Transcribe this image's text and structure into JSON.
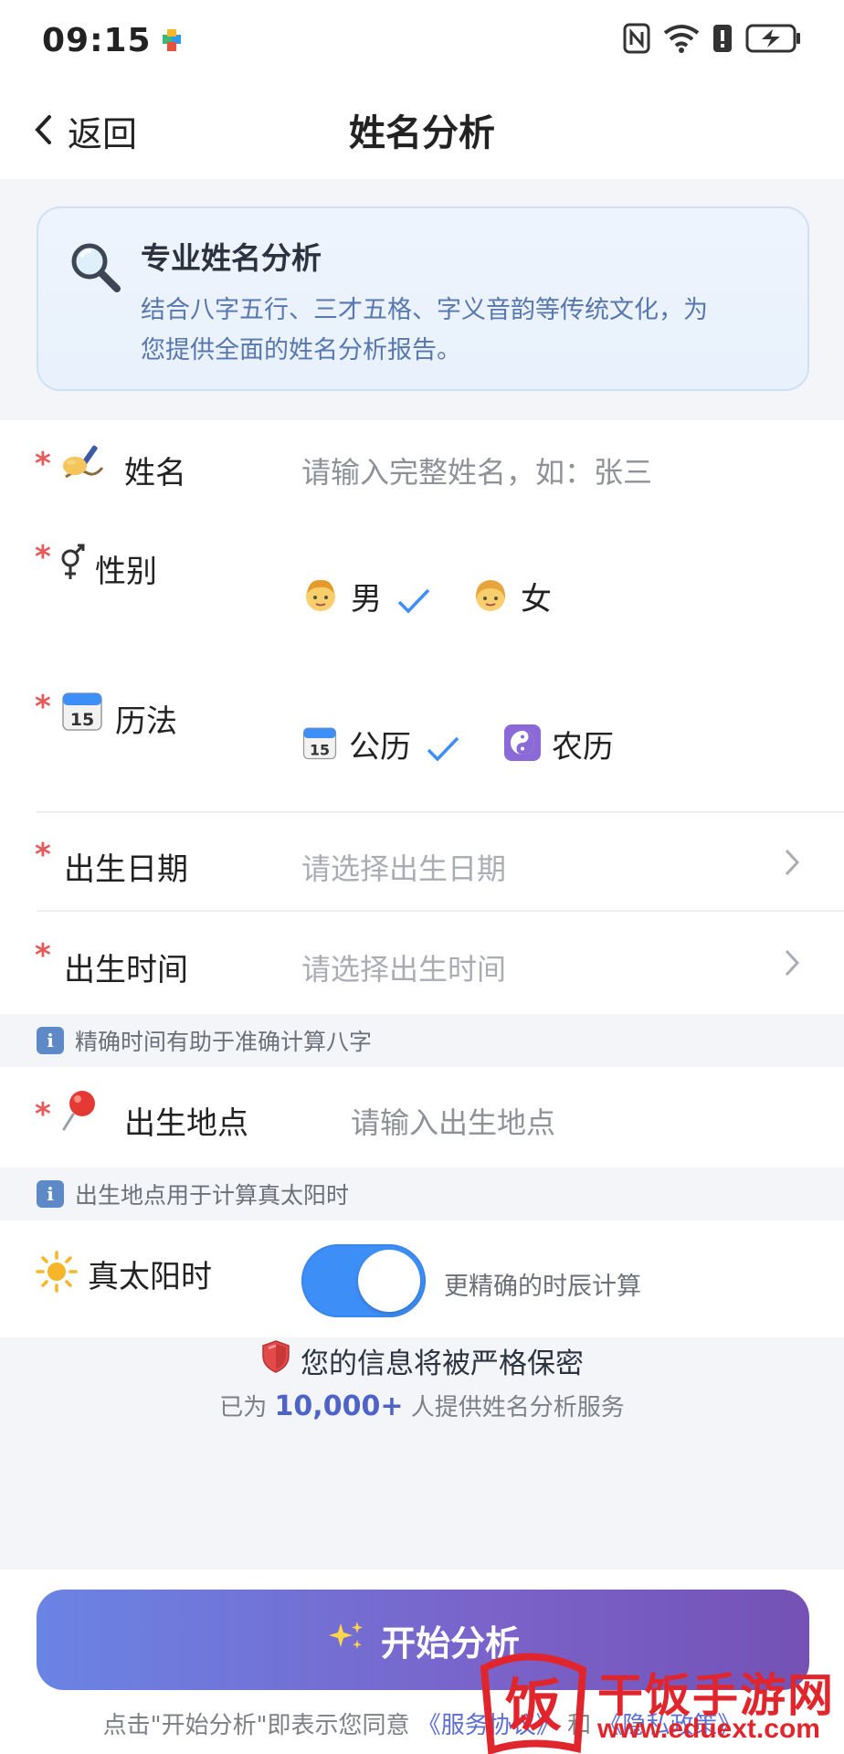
{
  "status_bar": {
    "time": "09:15"
  },
  "header": {
    "back_label": "返回",
    "title": "姓名分析"
  },
  "intro": {
    "title": "专业姓名分析",
    "desc_line1": "结合八字五行、三才五格、字义音韵等传统文化，为",
    "desc_line2": "您提供全面的姓名分析报告。"
  },
  "form": {
    "name": {
      "label": "姓名",
      "placeholder": "请输入完整姓名，如：张三"
    },
    "gender": {
      "label": "性别",
      "options": [
        "男",
        "女"
      ],
      "selected": "男"
    },
    "calendar": {
      "label": "历法",
      "options": [
        "公历",
        "农历"
      ],
      "selected": "公历"
    },
    "birth_date": {
      "label": "出生日期",
      "placeholder": "请选择出生日期"
    },
    "birth_time": {
      "label": "出生时间",
      "placeholder": "请选择出生时间",
      "tip": "精确时间有助于准确计算八字"
    },
    "birth_place": {
      "label": "出生地点",
      "placeholder": "请输入出生地点",
      "tip": "出生地点用于计算真太阳时"
    },
    "true_solar": {
      "label": "真太阳时",
      "enabled": true,
      "hint": "更精确的时辰计算"
    }
  },
  "privacy": {
    "line1": "您的信息将被严格保密",
    "prefix": "已为",
    "count": "10,000+",
    "suffix": "人提供姓名分析服务"
  },
  "bottom": {
    "start_label": "开始分析",
    "agree_prefix": "点击\"开始分析\"即表示您同意",
    "service_link": "《服务协议》",
    "and": "和",
    "privacy_link": "《隐私政策》"
  },
  "watermark": {
    "text": "干饭手游网",
    "url": "www.eduext.com",
    "logo_char": "饭"
  },
  "colors": {
    "accent": "#3d8ef7",
    "required": "#e65a5a",
    "button_start": "#6a84e4",
    "button_end": "#7452b5"
  }
}
